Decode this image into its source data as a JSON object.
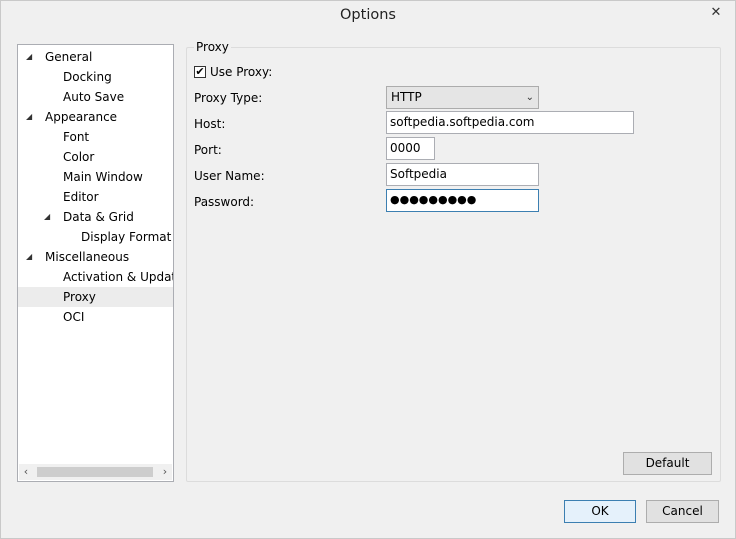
{
  "window": {
    "title": "Options",
    "close_glyph": "✕"
  },
  "tree": {
    "items": [
      {
        "label": "General",
        "expanded": true
      },
      {
        "label": "Docking"
      },
      {
        "label": "Auto Save"
      },
      {
        "label": "Appearance",
        "expanded": true
      },
      {
        "label": "Font"
      },
      {
        "label": "Color"
      },
      {
        "label": "Main Window"
      },
      {
        "label": "Editor"
      },
      {
        "label": "Data & Grid",
        "expanded": true
      },
      {
        "label": "Display Format"
      },
      {
        "label": "Miscellaneous",
        "expanded": true
      },
      {
        "label": "Activation & Updater"
      },
      {
        "label": "Proxy",
        "selected": true
      },
      {
        "label": "OCI"
      }
    ],
    "expand_glyph": "◢",
    "scroll_left": "‹",
    "scroll_right": "›"
  },
  "proxy": {
    "group_title": "Proxy",
    "use_proxy_label": "Use Proxy:",
    "use_proxy_checked": true,
    "check_glyph": "✔",
    "proxy_type_label": "Proxy Type:",
    "proxy_type_value": "HTTP",
    "combo_arrow": "⌄",
    "host_label": "Host:",
    "host_value": "softpedia.softpedia.com",
    "port_label": "Port:",
    "port_value": "0000",
    "username_label": "User Name:",
    "username_value": "Softpedia",
    "password_label": "Password:",
    "password_value": "●●●●●●●●●"
  },
  "buttons": {
    "default": "Default",
    "ok": "OK",
    "cancel": "Cancel"
  }
}
